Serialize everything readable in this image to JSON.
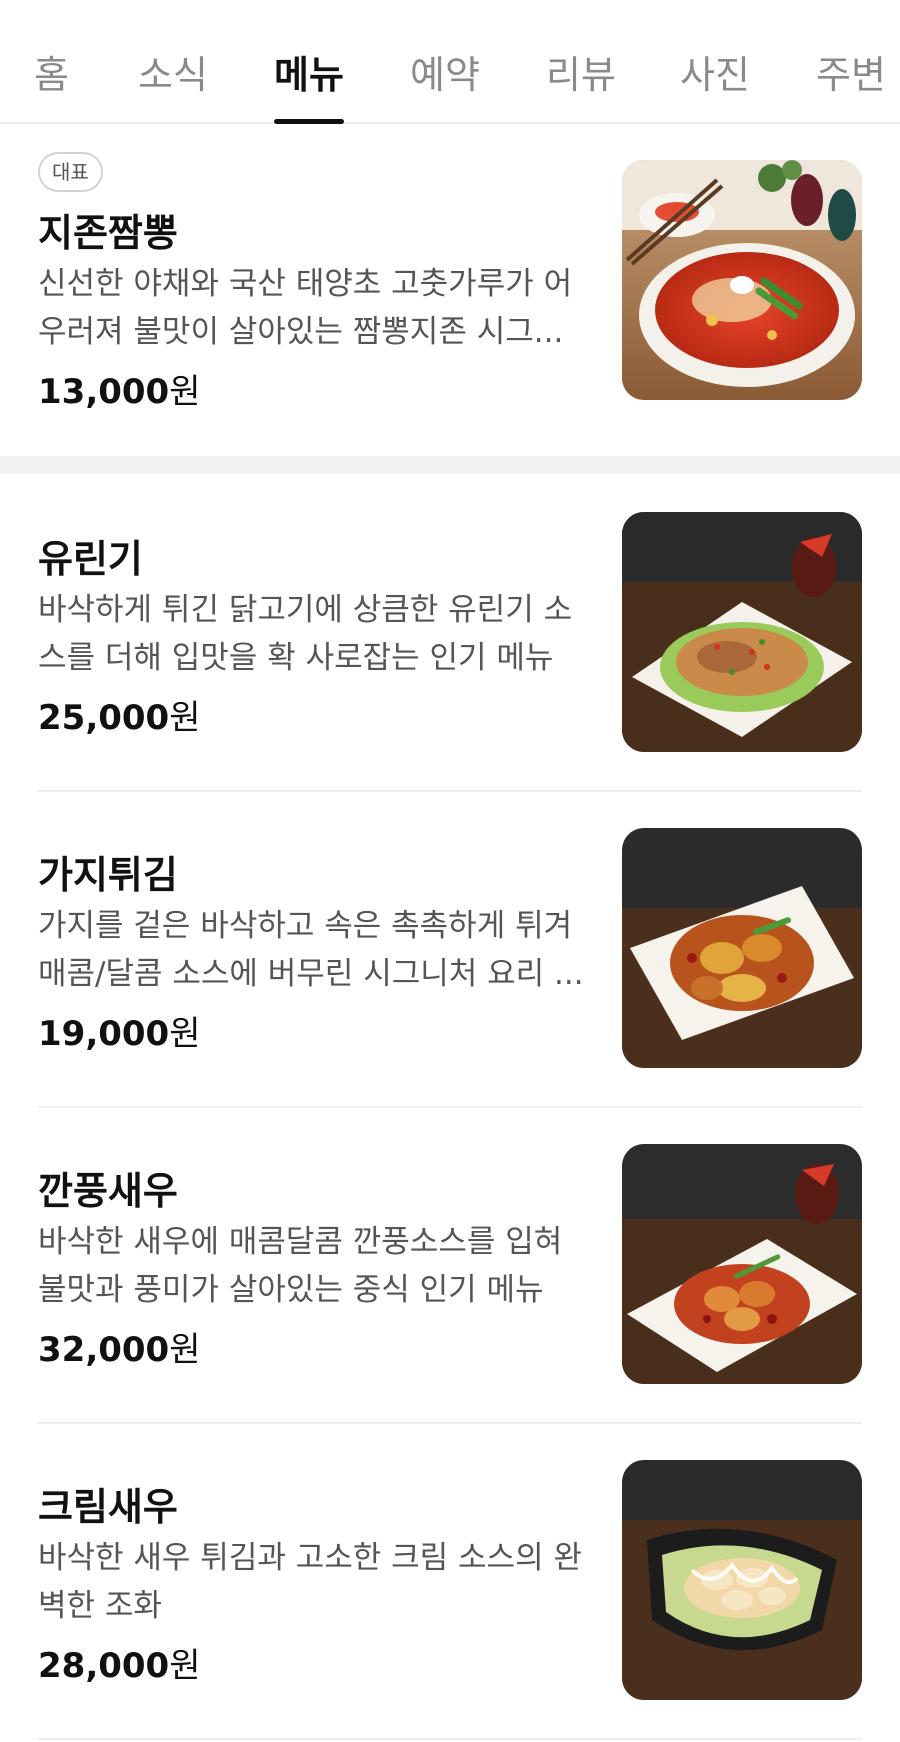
{
  "tabs": [
    {
      "label": "홈"
    },
    {
      "label": "소식"
    },
    {
      "label": "메뉴"
    },
    {
      "label": "예약"
    },
    {
      "label": "리뷰"
    },
    {
      "label": "사진"
    },
    {
      "label": "주변"
    }
  ],
  "active_tab": "메뉴",
  "menu": {
    "items": [
      {
        "badge": "대표",
        "name": "지존짬뽕",
        "description": "신선한 야채와 국산 태양초 고춧가루가 어우러져 불맛이 살아있는 짬뽕지존 시그...",
        "price": "13,000",
        "currency": "원",
        "image": "jjamppong-dish"
      },
      {
        "name": "유린기",
        "description": "바삭하게 튀긴 닭고기에 상큼한 유린기 소스를 더해 입맛을 확 사로잡는 인기 메뉴",
        "price": "25,000",
        "currency": "원",
        "image": "yuringi-dish"
      },
      {
        "name": "가지튀김",
        "description": "가지를 겉은 바삭하고 속은 촉촉하게 튀겨 매콤/달콤 소스에 버무린 시그니처 요리 ...",
        "price": "19,000",
        "currency": "원",
        "image": "fried-eggplant-dish"
      },
      {
        "name": "깐풍새우",
        "description": "바삭한 새우에 매콤달콤 깐풍소스를 입혀 불맛과 풍미가 살아있는 중식 인기 메뉴",
        "price": "32,000",
        "currency": "원",
        "image": "kkanpung-shrimp-dish"
      },
      {
        "name": "크림새우",
        "description": "바삭한 새우 튀김과 고소한 크림 소스의 완벽한 조화",
        "price": "28,000",
        "currency": "원",
        "image": "cream-shrimp-dish"
      }
    ]
  },
  "colors": {
    "active_tab": "#111111",
    "inactive_tab": "#8a8a8a",
    "description": "#555555",
    "separator": "#f1f1f1"
  }
}
